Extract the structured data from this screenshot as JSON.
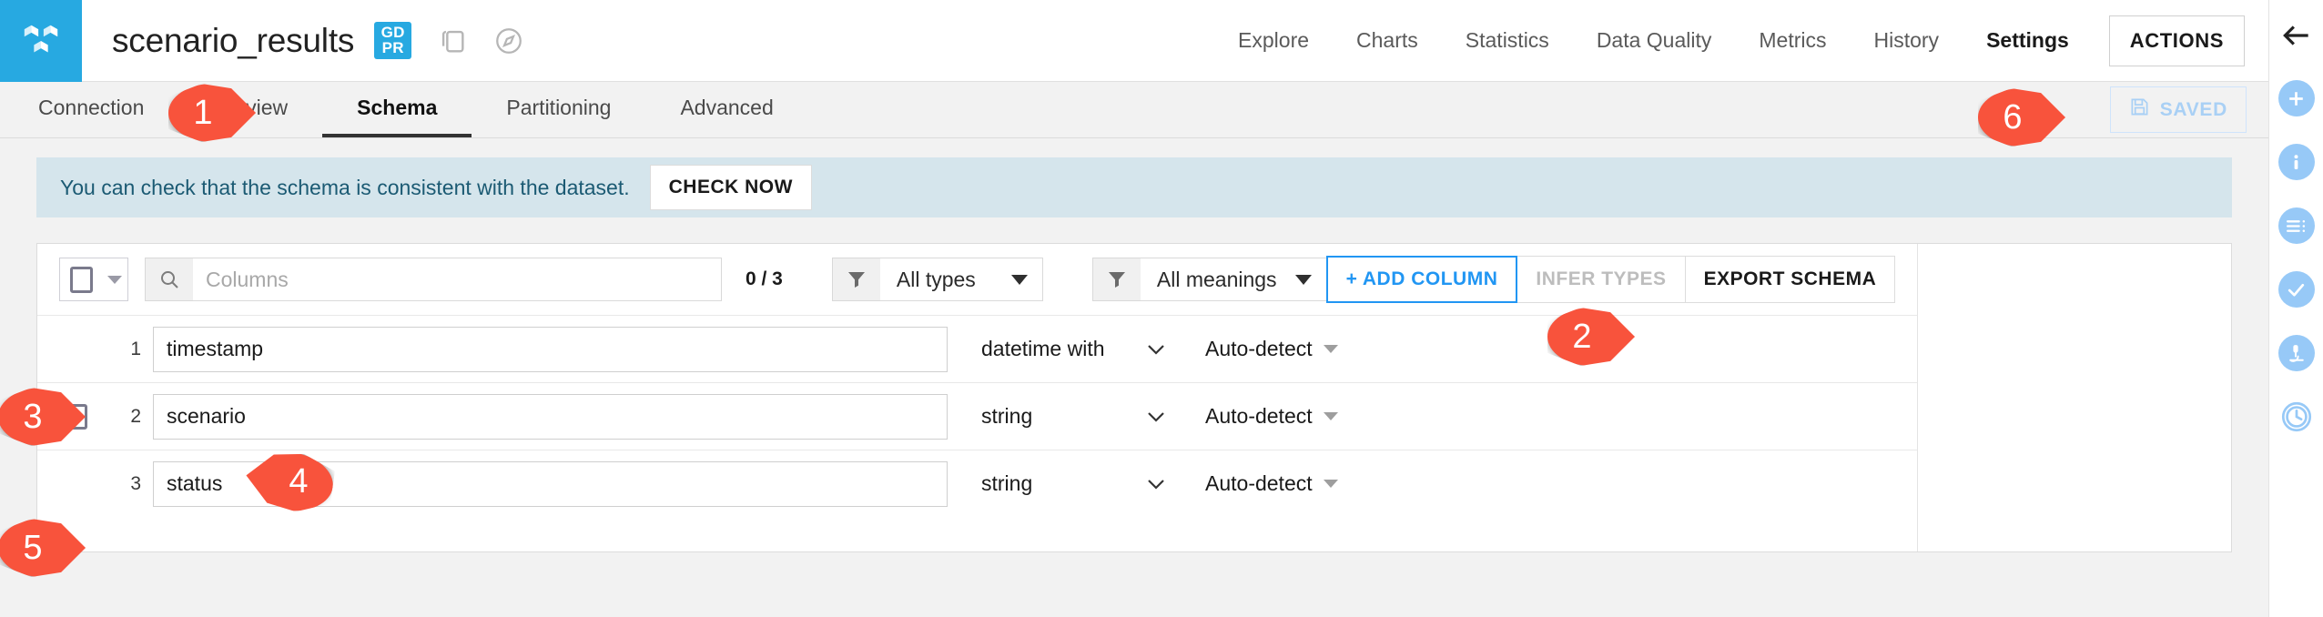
{
  "header": {
    "logo_icon": "dataiku-cubes-logo",
    "dataset_title": "scenario_results",
    "gdpr_line1": "GD",
    "gdpr_line2": "PR",
    "copy_icon": "copy-icon",
    "compass_icon": "compass-icon",
    "nav": [
      {
        "label": "Explore",
        "active": false
      },
      {
        "label": "Charts",
        "active": false
      },
      {
        "label": "Statistics",
        "active": false
      },
      {
        "label": "Data Quality",
        "active": false
      },
      {
        "label": "Metrics",
        "active": false
      },
      {
        "label": "History",
        "active": false
      },
      {
        "label": "Settings",
        "active": true
      }
    ],
    "actions_label": "ACTIONS"
  },
  "tabs": [
    {
      "label": "Connection",
      "active": false
    },
    {
      "label": "Preview",
      "active": false
    },
    {
      "label": "Schema",
      "active": true
    },
    {
      "label": "Partitioning",
      "active": false
    },
    {
      "label": "Advanced",
      "active": false
    }
  ],
  "saved_button": {
    "label": "SAVED",
    "icon": "floppy-disk-icon",
    "color": "#a9d0f5"
  },
  "banner": {
    "text": "You can check that the schema is consistent with the dataset.",
    "button_label": "CHECK NOW",
    "background": "#d5e5ec",
    "text_color": "#1b5a73"
  },
  "toolbar": {
    "select_all_checkbox": "unchecked",
    "search_placeholder": "Columns",
    "search_value": "",
    "count": "0 / 3",
    "type_filter": {
      "label": "All types",
      "icon": "filter-funnel-icon"
    },
    "meaning_filter": {
      "label": "All meanings",
      "icon": "filter-funnel-icon"
    },
    "add_column_label": "+ ADD COLUMN",
    "infer_types_label": "INFER TYPES",
    "export_schema_label": "EXPORT SCHEMA",
    "primary_color": "#2196f3",
    "disabled_color": "#bdbdbd"
  },
  "schema_rows": [
    {
      "index": "1",
      "name": "timestamp",
      "type": "datetime with",
      "meaning": "Auto-detect",
      "checkbox": "hidden"
    },
    {
      "index": "2",
      "name": "scenario",
      "type": "string",
      "meaning": "Auto-detect",
      "checkbox": "unchecked"
    },
    {
      "index": "3",
      "name": "status",
      "type": "string",
      "meaning": "Auto-detect",
      "checkbox": "hidden"
    }
  ],
  "annotations": [
    {
      "number": "1",
      "target": "tab-schema"
    },
    {
      "number": "2",
      "target": "add-column-button"
    },
    {
      "number": "3",
      "target": "row-1-checkbox"
    },
    {
      "number": "4",
      "target": "row-2-name-field"
    },
    {
      "number": "5",
      "target": "row-3-checkbox"
    },
    {
      "number": "6",
      "target": "saved-button"
    }
  ],
  "rail": {
    "back_icon": "back-arrow-icon",
    "items": [
      {
        "icon": "plus-icon"
      },
      {
        "icon": "info-icon"
      },
      {
        "icon": "details-list-icon"
      },
      {
        "icon": "check-icon"
      },
      {
        "icon": "microscope-icon"
      },
      {
        "icon": "clock-history-icon"
      }
    ],
    "accent": "#97c9f7"
  }
}
